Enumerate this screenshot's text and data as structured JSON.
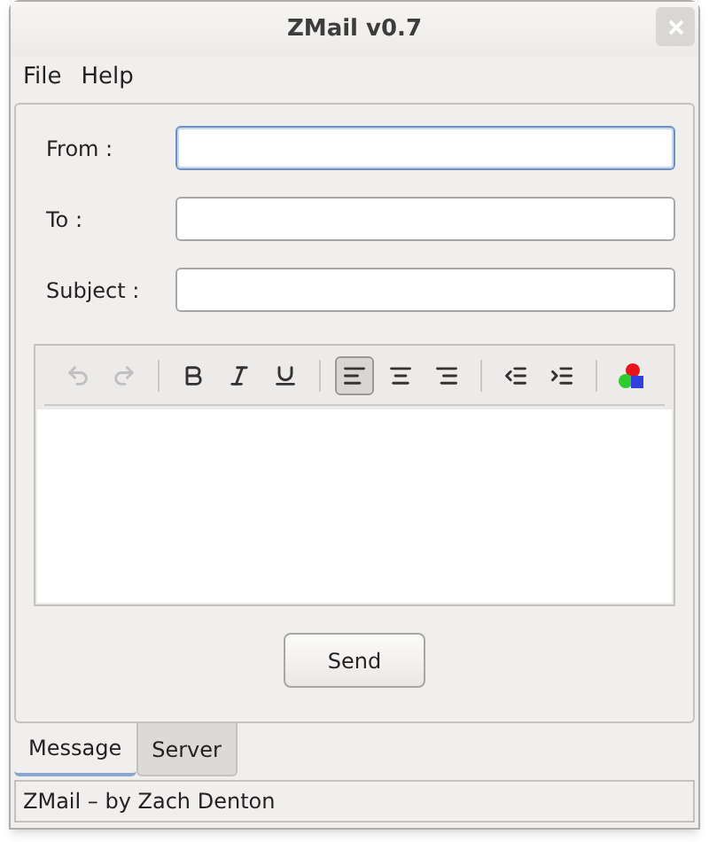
{
  "window": {
    "title": "ZMail v0.7"
  },
  "menu": [
    "File",
    "Help"
  ],
  "fields": [
    {
      "label": "From :",
      "focused": true
    },
    {
      "label": "To :",
      "focused": false
    },
    {
      "label": "Subject :",
      "focused": false
    }
  ],
  "toolbar": [
    {
      "kind": "undo",
      "disabled": true
    },
    {
      "kind": "redo",
      "disabled": true
    },
    {
      "kind": "separator"
    },
    {
      "kind": "bold",
      "disabled": false
    },
    {
      "kind": "italic",
      "disabled": false
    },
    {
      "kind": "underline",
      "disabled": false
    },
    {
      "kind": "separator"
    },
    {
      "kind": "align-left",
      "selected": true
    },
    {
      "kind": "align-center",
      "selected": false
    },
    {
      "kind": "align-right",
      "selected": false
    },
    {
      "kind": "separator"
    },
    {
      "kind": "outdent",
      "disabled": false
    },
    {
      "kind": "indent",
      "disabled": false
    },
    {
      "kind": "separator"
    },
    {
      "kind": "color",
      "disabled": false
    }
  ],
  "send_button": "Send",
  "tabs": [
    {
      "label": "Message",
      "selected": true
    },
    {
      "label": "Server",
      "selected": false
    }
  ],
  "status_bar": "ZMail – by Zach Denton"
}
